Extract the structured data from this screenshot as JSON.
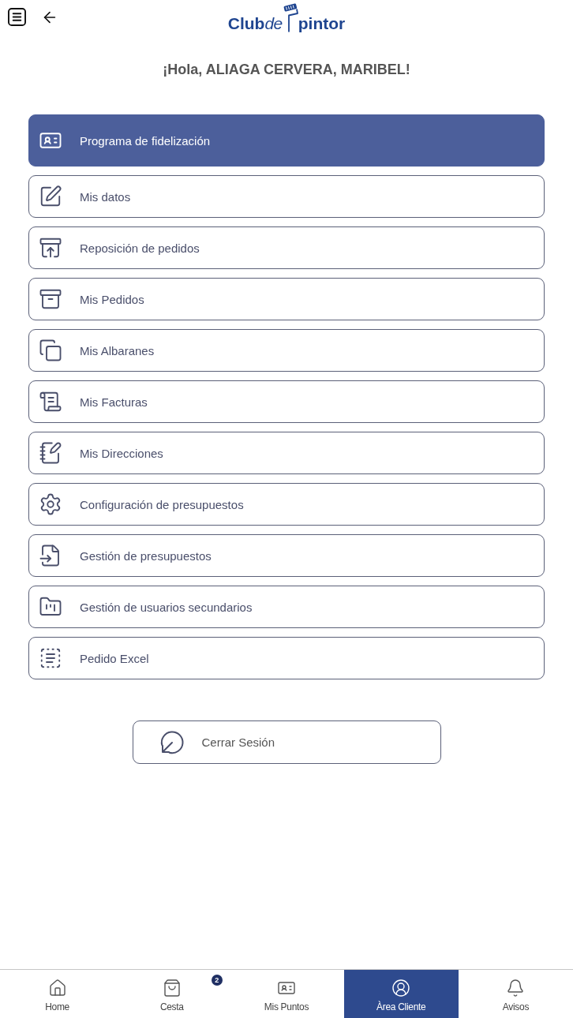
{
  "logo": {
    "name": "Club",
    "connector": "de",
    "tail": "pintor"
  },
  "greeting": "¡Hola, ALIAGA CERVERA, MARIBEL!",
  "menu": [
    {
      "label": "Programa de fidelización",
      "selected": true
    },
    {
      "label": "Mis datos",
      "selected": false
    },
    {
      "label": "Reposición de pedidos",
      "selected": false
    },
    {
      "label": "Mis Pedidos",
      "selected": false
    },
    {
      "label": "Mis Albaranes",
      "selected": false
    },
    {
      "label": "Mis Facturas",
      "selected": false
    },
    {
      "label": "Mis Direcciones",
      "selected": false
    },
    {
      "label": "Configuración de presupuestos",
      "selected": false
    },
    {
      "label": "Gestión de presupuestos",
      "selected": false
    },
    {
      "label": "Gestión de usuarios secundarios",
      "selected": false
    },
    {
      "label": "Pedido Excel",
      "selected": false
    }
  ],
  "logout": {
    "label": "Cerrar Sesión"
  },
  "bottom_nav": [
    {
      "label": "Home",
      "selected": false
    },
    {
      "label": "Cesta",
      "selected": false,
      "badge": "2"
    },
    {
      "label": "Mis Puntos",
      "selected": false
    },
    {
      "label": "Àrea Cliente",
      "selected": true
    },
    {
      "label": "Avisos",
      "selected": false
    }
  ]
}
